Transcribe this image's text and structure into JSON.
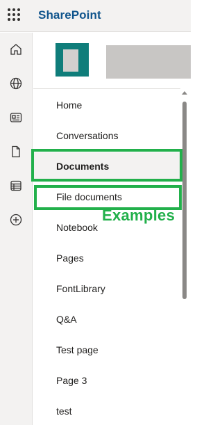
{
  "app": {
    "title": "SharePoint"
  },
  "rail": {
    "icons": [
      "home-icon",
      "globe-icon",
      "news-icon",
      "document-icon",
      "list-icon",
      "add-icon"
    ]
  },
  "nav": {
    "items": [
      {
        "label": "Home"
      },
      {
        "label": "Conversations"
      },
      {
        "label": "Documents",
        "selected": true
      },
      {
        "label": "File documents"
      },
      {
        "label": "Notebook"
      },
      {
        "label": "Pages"
      },
      {
        "label": "FontLibrary"
      },
      {
        "label": "Q&A"
      },
      {
        "label": "Test page"
      },
      {
        "label": "Page 3"
      },
      {
        "label": "test"
      }
    ]
  },
  "annotation": {
    "label": "Examples",
    "color": "#22b04b"
  },
  "colors": {
    "brand": "#0f548c",
    "site_logo": "#0f7d7a",
    "selected_bg": "#f3f2f1"
  }
}
